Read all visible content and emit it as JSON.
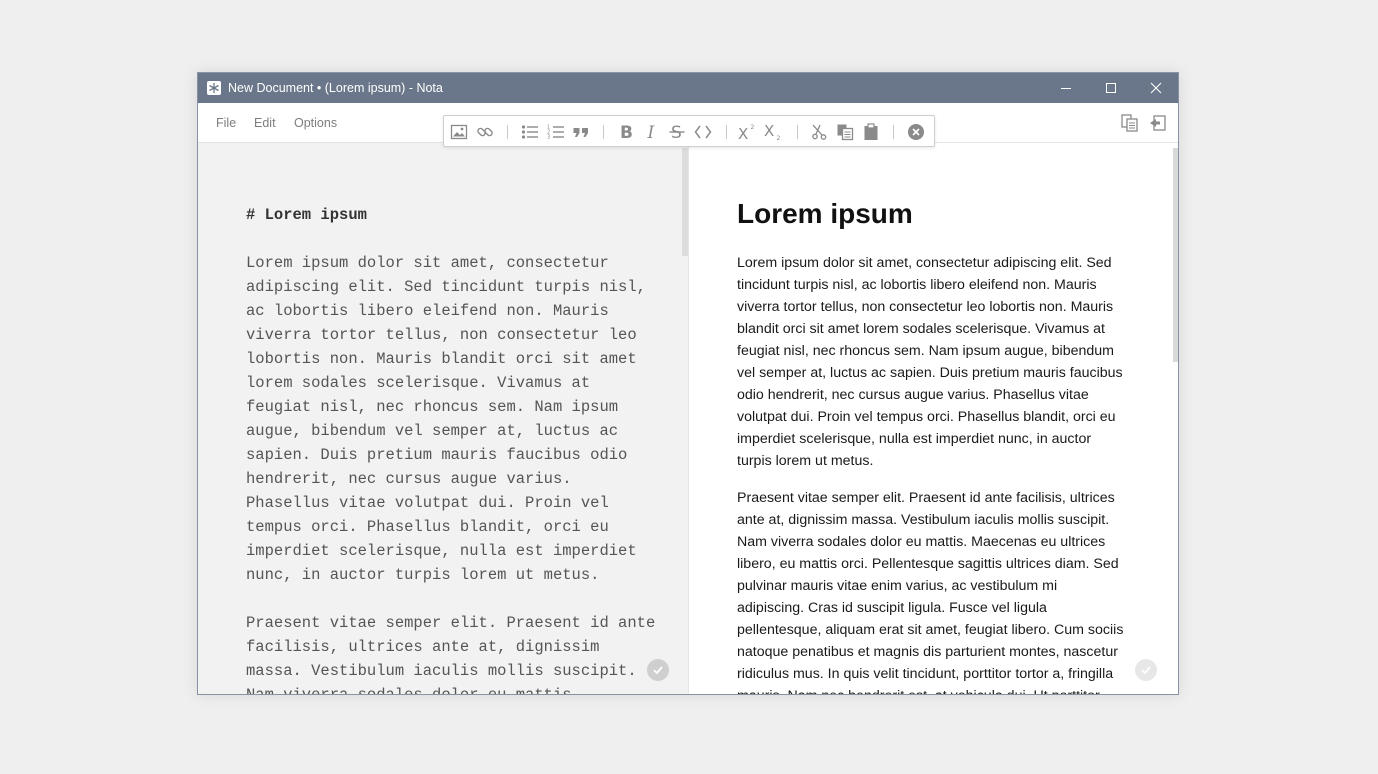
{
  "window": {
    "title": "New Document • (Lorem ipsum) - Nota"
  },
  "menu": {
    "file": "File",
    "edit": "Edit",
    "options": "Options"
  },
  "toolbar": {
    "icons": [
      "image-icon",
      "link-icon",
      "bullet-list-icon",
      "numbered-list-icon",
      "blockquote-icon",
      "bold-icon",
      "italic-icon",
      "strikethrough-icon",
      "code-icon",
      "superscript-icon",
      "subscript-icon",
      "cut-icon",
      "copy-icon",
      "paste-icon",
      "close-toolbar-icon"
    ]
  },
  "editor": {
    "heading": "# Lorem ipsum",
    "paragraph1": "Lorem ipsum dolor sit amet, consectetur adipiscing elit. Sed tincidunt turpis nisl, ac lobortis libero eleifend non. Mauris viverra tortor tellus, non consectetur leo lobortis non. Mauris blandit orci sit amet lorem sodales scelerisque. Vivamus at feugiat nisl, nec rhoncus sem. Nam ipsum augue, bibendum vel semper at, luctus ac sapien. Duis pretium mauris faucibus odio hendrerit, nec cursus augue varius. Phasellus vitae volutpat dui. Proin vel tempus orci. Phasellus blandit, orci eu imperdiet scelerisque, nulla est imperdiet nunc, in auctor turpis lorem ut metus.",
    "paragraph2": "Praesent vitae semper elit. Praesent id ante facilisis, ultrices ante at, dignissim massa. Vestibulum iaculis mollis suscipit. Nam viverra sodales dolor eu mattis."
  },
  "preview": {
    "heading": "Lorem ipsum",
    "paragraph1": "Lorem ipsum dolor sit amet, consectetur adipiscing elit. Sed tincidunt turpis nisl, ac lobortis libero eleifend non. Mauris viverra tortor tellus, non consectetur leo lobortis non. Mauris blandit orci sit amet lorem sodales scelerisque. Vivamus at feugiat nisl, nec rhoncus sem. Nam ipsum augue, bibendum vel semper at, luctus ac sapien. Duis pretium mauris faucibus odio hendrerit, nec cursus augue varius. Phasellus vitae volutpat dui. Proin vel tempus orci. Phasellus blandit, orci eu imperdiet scelerisque, nulla est imperdiet nunc, in auctor turpis lorem ut metus.",
    "paragraph2": "Praesent vitae semper elit. Praesent id ante facilisis, ultrices ante at, dignissim massa. Vestibulum iaculis mollis suscipit. Nam viverra sodales dolor eu mattis. Maecenas eu ultrices libero, eu mattis orci. Pellentesque sagittis ultrices diam. Sed pulvinar mauris vitae enim varius, ac vestibulum mi adipiscing. Cras id suscipit ligula. Fusce vel ligula pellentesque, aliquam erat sit amet, feugiat libero. Cum sociis natoque penatibus et magnis dis parturient montes, nascetur ridiculus mus. In quis velit tincidunt, porttitor tortor a, fringilla mauris. Nam nec hendrerit est, at vehicula dui. Ut porttitor"
  },
  "colors": {
    "titlebar": "#6a778a",
    "editor_bg": "#f2f2f2",
    "icon_gray": "#8a8a8a"
  }
}
